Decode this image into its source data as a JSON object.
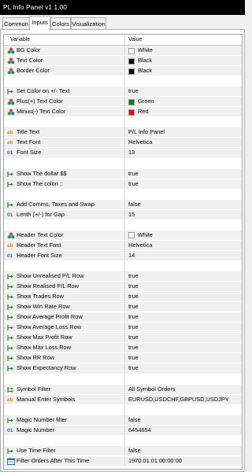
{
  "window": {
    "title": "PL Info Panel v1 1.00"
  },
  "tabs": [
    {
      "label": "Common",
      "active": false
    },
    {
      "label": "Inputs",
      "active": true
    },
    {
      "label": "Colors",
      "active": false
    },
    {
      "label": "Visualization",
      "active": false
    }
  ],
  "table": {
    "col_variable": "Variable",
    "col_value": "Value",
    "rows": [
      {
        "type": "data",
        "icon": "color-icon",
        "label": "BG Color",
        "swatch": "#ffffff",
        "value": "White"
      },
      {
        "type": "data",
        "icon": "color-icon",
        "label": "Text Color",
        "swatch": "#000000",
        "value": "Black"
      },
      {
        "type": "data",
        "icon": "color-icon",
        "label": "Border Color",
        "swatch": "#000000",
        "value": "Black"
      },
      {
        "type": "sep"
      },
      {
        "type": "data",
        "icon": "bool-icon",
        "label": "Set Color on +/- Text",
        "value": "true"
      },
      {
        "type": "data",
        "icon": "color-icon",
        "label": "Plus(+) Text Color",
        "swatch": "#008000",
        "value": "Green"
      },
      {
        "type": "data",
        "icon": "color-icon",
        "label": "Minus(-) Text Color",
        "swatch": "#ff0000",
        "value": "Red"
      },
      {
        "type": "sep"
      },
      {
        "type": "data",
        "icon": "string-icon",
        "label": "Title Text",
        "value": "P/L Info Panel"
      },
      {
        "type": "data",
        "icon": "string-icon",
        "label": "Text Font",
        "value": "Helvetica"
      },
      {
        "type": "data",
        "icon": "int-icon",
        "label": "Font Size",
        "value": "13"
      },
      {
        "type": "sep"
      },
      {
        "type": "data",
        "icon": "bool-icon",
        "label": "Show The dollar $$",
        "value": "true"
      },
      {
        "type": "data",
        "icon": "bool-icon",
        "label": "Show The colon ::",
        "value": "true"
      },
      {
        "type": "sep"
      },
      {
        "type": "data",
        "icon": "bool-icon",
        "label": "Add Comms, Taxes and Swap",
        "value": "false"
      },
      {
        "type": "data",
        "icon": "int-icon",
        "label": "Lenth (+/-) for Gap",
        "value": "15"
      },
      {
        "type": "sep"
      },
      {
        "type": "data",
        "icon": "color-icon",
        "label": "Header Text Color",
        "swatch": "#ffffff",
        "value": "White"
      },
      {
        "type": "data",
        "icon": "string-icon",
        "label": "Header Text Font",
        "value": "Helvetica"
      },
      {
        "type": "data",
        "icon": "int-icon",
        "label": "Header Font Size",
        "value": "14"
      },
      {
        "type": "sep"
      },
      {
        "type": "data",
        "icon": "bool-icon",
        "label": "Show Unrealised P/L Row",
        "value": "true"
      },
      {
        "type": "data",
        "icon": "bool-icon",
        "label": "Show Realised P/L Row",
        "value": "true"
      },
      {
        "type": "data",
        "icon": "bool-icon",
        "label": "Show Trades Row",
        "value": "true"
      },
      {
        "type": "data",
        "icon": "bool-icon",
        "label": "Show Win Rate Row",
        "value": "true"
      },
      {
        "type": "data",
        "icon": "bool-icon",
        "label": "Show Average Profit Row",
        "value": "true"
      },
      {
        "type": "data",
        "icon": "bool-icon",
        "label": "Show Average Loss Row",
        "value": "true"
      },
      {
        "type": "data",
        "icon": "bool-icon",
        "label": "Show Max Profit Row",
        "value": "true"
      },
      {
        "type": "data",
        "icon": "bool-icon",
        "label": "Show Max Loss Row",
        "value": "true"
      },
      {
        "type": "data",
        "icon": "bool-icon",
        "label": "Show RR Row",
        "value": "true"
      },
      {
        "type": "data",
        "icon": "bool-icon",
        "label": "Show Expectancy Row",
        "value": "true"
      },
      {
        "type": "sep"
      },
      {
        "type": "data",
        "icon": "enum-icon",
        "label": "Symbol Filter",
        "value": "All Symbol Orders"
      },
      {
        "type": "data",
        "icon": "string-icon",
        "label": "Manual Enter Symbols",
        "value": "EURUSD,USDCHF,GBPUSD,USDJPY"
      },
      {
        "type": "sep"
      },
      {
        "type": "data",
        "icon": "bool-icon",
        "label": "Magic Number filter",
        "value": "false"
      },
      {
        "type": "data",
        "icon": "int-icon",
        "label": "Magic Number",
        "value": "6454654"
      },
      {
        "type": "sep"
      },
      {
        "type": "data",
        "icon": "bool-icon",
        "label": "Use Time Filter",
        "value": "false"
      },
      {
        "type": "data",
        "icon": "datetime-icon",
        "label": "Filter Orders After This Time",
        "value": "1970.01.01 00:00:00"
      }
    ]
  },
  "icon_glyphs": {
    "string-icon": "ab",
    "int-icon": "01"
  },
  "colors": {
    "titlebar_bg": "#000000",
    "row_bg": "#f0f0f0",
    "icon_green": "#2e8b2e",
    "icon_orange": "#d28c1e",
    "icon_blue": "#2b6fc0"
  }
}
